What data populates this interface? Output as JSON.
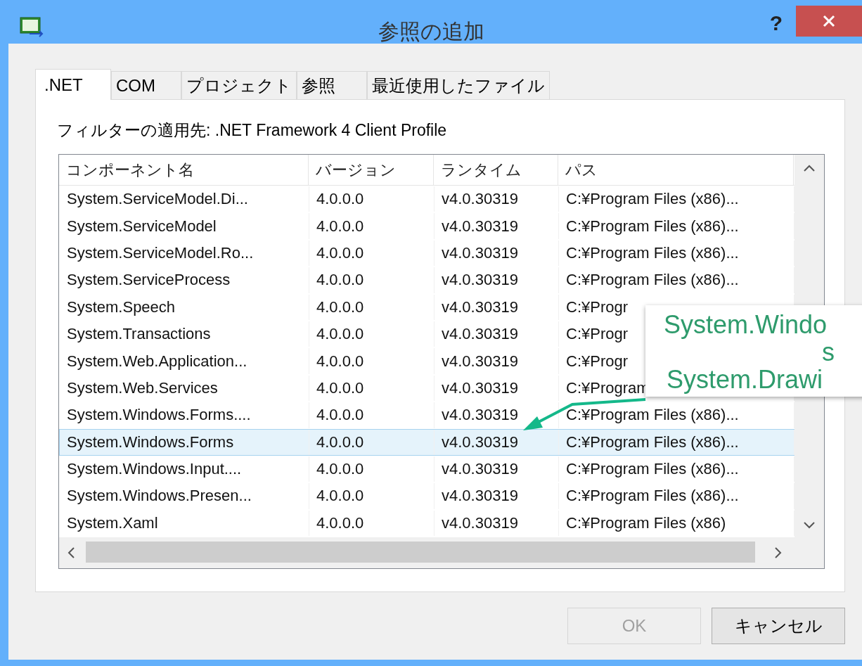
{
  "window": {
    "title": "参照の追加",
    "help": "?"
  },
  "tabs": [
    {
      "label": ".NET",
      "selected": true
    },
    {
      "label": "COM",
      "selected": false
    },
    {
      "label": "プロジェクト",
      "selected": false
    },
    {
      "label": "参照",
      "selected": false
    },
    {
      "label": "最近使用したファイル",
      "selected": false
    }
  ],
  "filter_label": "フィルターの適用先: .NET Framework 4 Client Profile",
  "table": {
    "columns": [
      "コンポーネント名",
      "バージョン",
      "ランタイム",
      "パス"
    ],
    "rows": [
      {
        "cells": [
          "System.ServiceModel.Di...",
          "4.0.0.0",
          "v4.0.30319",
          "C:¥Program Files (x86)..."
        ],
        "selected": false
      },
      {
        "cells": [
          "System.ServiceModel",
          "4.0.0.0",
          "v4.0.30319",
          "C:¥Program Files (x86)..."
        ],
        "selected": false
      },
      {
        "cells": [
          "System.ServiceModel.Ro...",
          "4.0.0.0",
          "v4.0.30319",
          "C:¥Program Files (x86)..."
        ],
        "selected": false
      },
      {
        "cells": [
          "System.ServiceProcess",
          "4.0.0.0",
          "v4.0.30319",
          "C:¥Program Files (x86)..."
        ],
        "selected": false
      },
      {
        "cells": [
          "System.Speech",
          "4.0.0.0",
          "v4.0.30319",
          "C:¥Progr"
        ],
        "selected": false
      },
      {
        "cells": [
          "System.Transactions",
          "4.0.0.0",
          "v4.0.30319",
          "C:¥Progr"
        ],
        "selected": false
      },
      {
        "cells": [
          "System.Web.Application...",
          "4.0.0.0",
          "v4.0.30319",
          "C:¥Progr"
        ],
        "selected": false
      },
      {
        "cells": [
          "System.Web.Services",
          "4.0.0.0",
          "v4.0.30319",
          "C:¥Program"
        ],
        "selected": false
      },
      {
        "cells": [
          "System.Windows.Forms....",
          "4.0.0.0",
          "v4.0.30319",
          "C:¥Program Files (x86)..."
        ],
        "selected": false
      },
      {
        "cells": [
          "System.Windows.Forms",
          "4.0.0.0",
          "v4.0.30319",
          "C:¥Program Files (x86)..."
        ],
        "selected": true
      },
      {
        "cells": [
          "System.Windows.Input....",
          "4.0.0.0",
          "v4.0.30319",
          "C:¥Program Files (x86)..."
        ],
        "selected": false
      },
      {
        "cells": [
          "System.Windows.Presen...",
          "4.0.0.0",
          "v4.0.30319",
          "C:¥Program Files (x86)..."
        ],
        "selected": false
      },
      {
        "cells": [
          "System.Xaml",
          "4.0.0.0",
          "v4.0.30319",
          "C:¥Program Files (x86)"
        ],
        "selected": false
      }
    ]
  },
  "buttons": [
    {
      "label": "OK",
      "disabled": true
    },
    {
      "label": "キャンセル",
      "disabled": false
    }
  ],
  "callout": {
    "lines": [
      "System.Windo",
      "s",
      "System.Drawi"
    ]
  }
}
